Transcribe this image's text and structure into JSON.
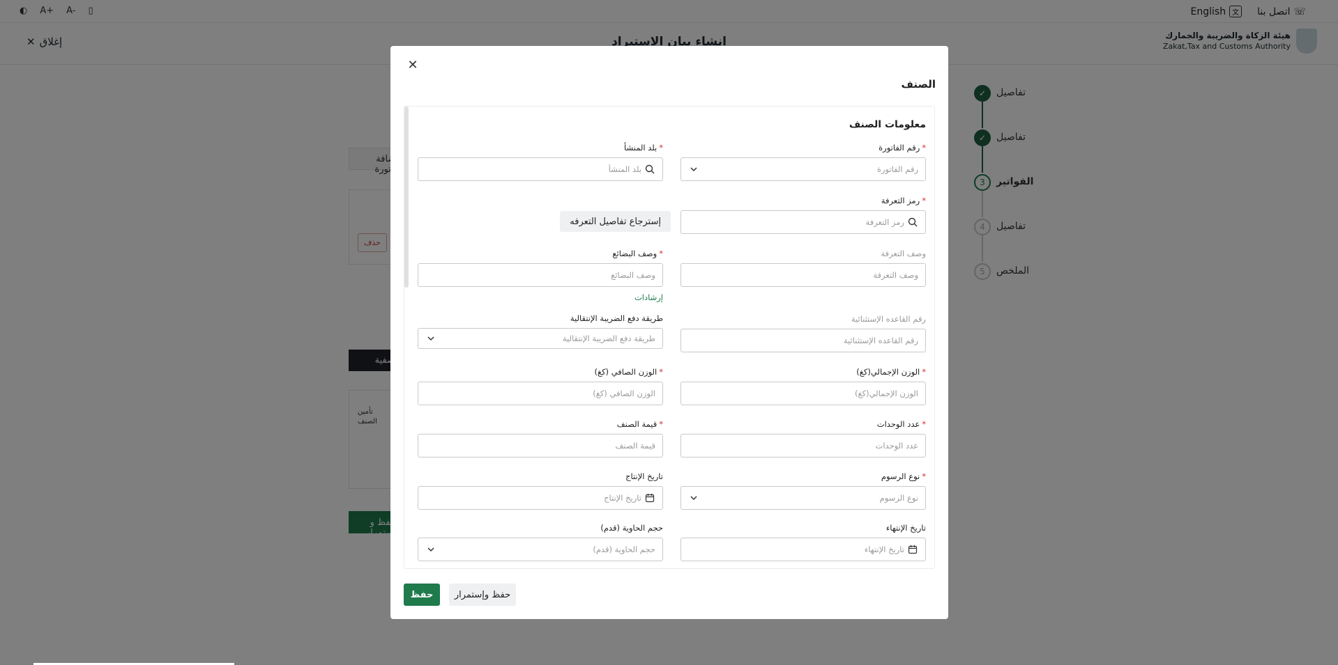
{
  "topbar": {
    "tools_left": [
      "◐",
      "A+",
      "A-",
      "▯"
    ],
    "language_label": "English",
    "contact_label": "اتصل بنا"
  },
  "header": {
    "close_label": "إغلاق",
    "page_title": "انشاء بيان الاستيراد",
    "logo_ar": "هيئة الزكاة والضريبة والجمارك",
    "logo_en": "Zakat,Tax and Customs Authority"
  },
  "stepper": {
    "steps": [
      {
        "label": "تفاصيل",
        "num": "",
        "status": "done"
      },
      {
        "label": "تفاصيل",
        "num": "",
        "status": "done"
      },
      {
        "label": "الفواتير",
        "num": "3",
        "status": "current"
      },
      {
        "label": "تفاصيل",
        "num": "4",
        "status": "todo"
      },
      {
        "label": "الملخص",
        "num": "5",
        "status": "todo"
      }
    ]
  },
  "background": {
    "add_invoice": "إضافة فاتورة",
    "delete": "حذف",
    "filter": "تصفية",
    "insurance": "تأمين الصنف",
    "save_continue": "حفظ و استمرار"
  },
  "modal": {
    "title": "الصنف",
    "section_title": "معلومات الصنف",
    "fields": {
      "invoice_number": {
        "label": "رقم الفاتورة",
        "placeholder": "رقم الفاتورة"
      },
      "origin_country": {
        "label": "بلد المنشأ",
        "placeholder": "بلد المنشأ"
      },
      "tariff_code": {
        "label": "رمز التعرفة",
        "placeholder": "رمز التعرفة"
      },
      "retrieve_button": "إسترجاع تفاصيل التعرفه",
      "tariff_description": {
        "label": "وصف التعرفة",
        "placeholder": "وصف التعرفة"
      },
      "goods_description": {
        "label": "وصف البضائع",
        "placeholder": "وصف البضائع"
      },
      "guidelines_link": "إرشادات",
      "exception_rule": {
        "label": "رقم القاعده الإستثنائية",
        "placeholder": "رقم القاعده الإستثنائية"
      },
      "transit_tax_method": {
        "label": "طريقة دفع الضريبة الإنتقالية",
        "placeholder": "طريقة دفع الضريبة الإنتقالية"
      },
      "gross_weight": {
        "label": "الوزن الإجمالي(كغ)",
        "placeholder": "الوزن الإجمالي(كغ)"
      },
      "net_weight": {
        "label": "الوزن الصافي (كغ)",
        "placeholder": "الوزن الصافي (كغ)"
      },
      "units_count": {
        "label": "عدد الوحدات",
        "placeholder": "عدد الوحدات"
      },
      "item_value": {
        "label": "قيمة الصنف",
        "placeholder": "قيمة الصنف"
      },
      "fee_type": {
        "label": "نوع الرسوم",
        "placeholder": "نوع الرسوم"
      },
      "production_date": {
        "label": "تاريخ الإنتاج",
        "placeholder": "تاريخ الإنتاج"
      },
      "expiry_date": {
        "label": "تاريخ الإنتهاء",
        "placeholder": "تاريخ الإنتهاء"
      },
      "container_size": {
        "label": "حجم الحاوية (قدم)",
        "placeholder": "حجم الحاوية (قدم)"
      }
    },
    "save_button": "حفظ",
    "save_continue_button": "حفظ وإستمرار"
  }
}
